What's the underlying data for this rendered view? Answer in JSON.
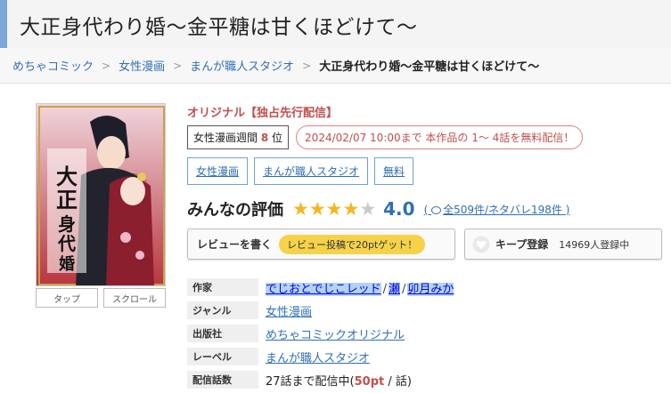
{
  "page_title": "大正身代わり婚～金平糖は甘くほどけて～",
  "breadcrumb": {
    "items": [
      "めちゃコミック",
      "女性漫画",
      "まんが職人スタジオ"
    ],
    "current": "大正身代わり婚～金平糖は甘くほどけて～",
    "separator": ">"
  },
  "cover": {
    "title_text": "大正身代わり婚",
    "buttons": [
      "タップ",
      "スクロール"
    ]
  },
  "original_label": "オリジナル【独占先行配信】",
  "ranking": {
    "prefix": "女性漫画週間",
    "rank": "8",
    "suffix": "位"
  },
  "free_notice": "2024/02/07 10:00まで 本作品の 1～ 4話を無料配信！",
  "tags": [
    "女性漫画",
    "まんが職人スタジオ",
    "無料"
  ],
  "rating": {
    "label": "みんなの評価",
    "score": "4.0",
    "stars_filled": 4,
    "stars_total": 5,
    "reviews_text": "全509件/ネタバレ198件",
    "paren_open": "(",
    "paren_close": ")"
  },
  "actions": {
    "review_label": "レビューを書く",
    "review_promo": "レビュー投稿で20ptゲット！",
    "keep_label": "キープ登録",
    "keep_count": "14969人登録中"
  },
  "meta": {
    "author_key": "作家",
    "authors": [
      "でじおとでじこレッド",
      "瀬",
      "卯月みか"
    ],
    "author_sep": "/",
    "genre_key": "ジャンル",
    "genre": "女性漫画",
    "publisher_key": "出版社",
    "publisher": "めちゃコミックオリジナル",
    "label_key": "レーベル",
    "label": "まんが職人スタジオ",
    "episodes_key": "配信話数",
    "episodes_prefix": "27話まで配信中(",
    "episodes_price": "50pt",
    "episodes_suffix": " / 話)"
  },
  "colors": {
    "accent_blue": "#2f6fb5",
    "title_bar_border": "#7aa7d6",
    "red": "#c0504d",
    "star": "#f3b61f",
    "promo_yellow": "#f5d24a"
  }
}
